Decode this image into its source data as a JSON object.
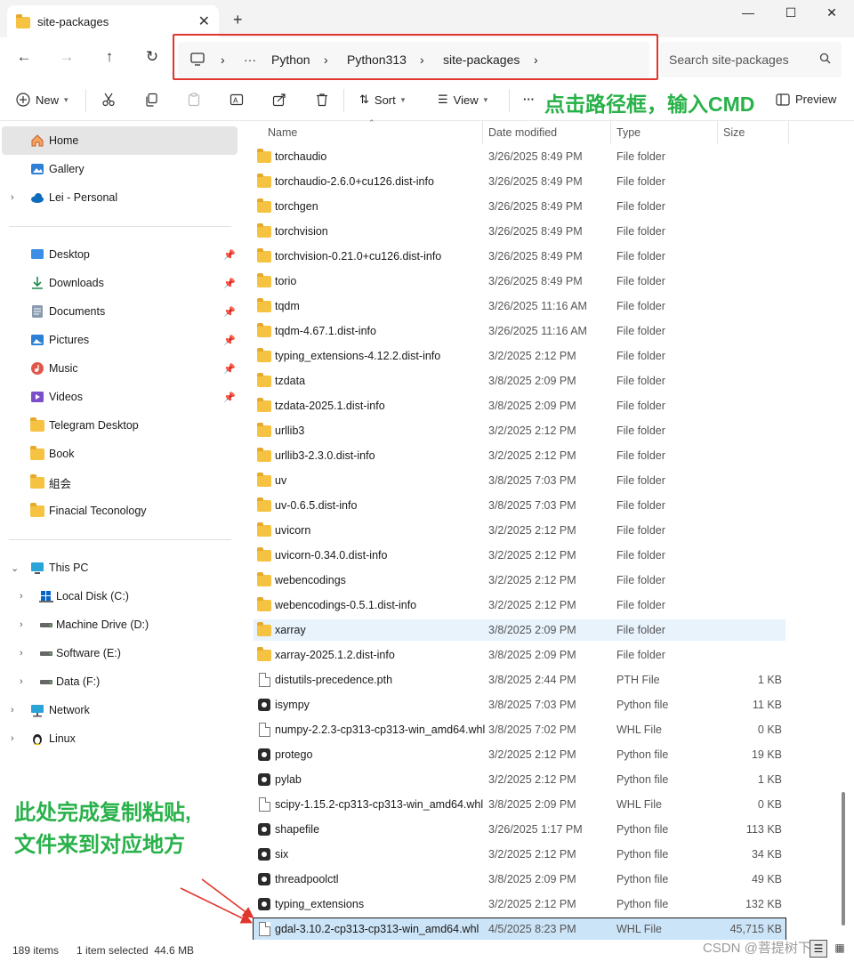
{
  "window": {
    "tab_title": "site-packages",
    "new_tab_glyph": "+",
    "tab_close_glyph": "✕",
    "minimize_glyph": "—",
    "maximize_glyph": "☐",
    "close_glyph": "✕"
  },
  "address": {
    "overflow": "···",
    "crumbs": [
      "Python",
      "Python313",
      "site-packages"
    ],
    "separator": "›",
    "search_placeholder": "Search site-packages"
  },
  "command_bar": {
    "new_label": "New",
    "sort_label": "Sort",
    "view_label": "View",
    "more_label": "···",
    "preview_label": "Preview",
    "annotation": "点击路径框，输入CMD"
  },
  "sidebar": {
    "home": "Home",
    "gallery": "Gallery",
    "onedrive": "Lei - Personal",
    "quick_access": [
      "Desktop",
      "Downloads",
      "Documents",
      "Pictures",
      "Music",
      "Videos",
      "Telegram Desktop",
      "Book",
      "組会",
      "Finacial Teconology"
    ],
    "this_pc": "This PC",
    "drives": [
      "Local Disk (C:)",
      "Machine Drive (D:)",
      "Software (E:)",
      "Data (F:)"
    ],
    "network": "Network",
    "linux": "Linux"
  },
  "columns": {
    "name": "Name",
    "date": "Date modified",
    "type": "Type",
    "size": "Size"
  },
  "files": [
    {
      "name": "torchaudio",
      "date": "3/26/2025 8:49 PM",
      "type": "File folder",
      "size": "",
      "icon": "folder"
    },
    {
      "name": "torchaudio-2.6.0+cu126.dist-info",
      "date": "3/26/2025 8:49 PM",
      "type": "File folder",
      "size": "",
      "icon": "folder"
    },
    {
      "name": "torchgen",
      "date": "3/26/2025 8:49 PM",
      "type": "File folder",
      "size": "",
      "icon": "folder"
    },
    {
      "name": "torchvision",
      "date": "3/26/2025 8:49 PM",
      "type": "File folder",
      "size": "",
      "icon": "folder"
    },
    {
      "name": "torchvision-0.21.0+cu126.dist-info",
      "date": "3/26/2025 8:49 PM",
      "type": "File folder",
      "size": "",
      "icon": "folder"
    },
    {
      "name": "torio",
      "date": "3/26/2025 8:49 PM",
      "type": "File folder",
      "size": "",
      "icon": "folder"
    },
    {
      "name": "tqdm",
      "date": "3/26/2025 11:16 AM",
      "type": "File folder",
      "size": "",
      "icon": "folder"
    },
    {
      "name": "tqdm-4.67.1.dist-info",
      "date": "3/26/2025 11:16 AM",
      "type": "File folder",
      "size": "",
      "icon": "folder"
    },
    {
      "name": "typing_extensions-4.12.2.dist-info",
      "date": "3/2/2025 2:12 PM",
      "type": "File folder",
      "size": "",
      "icon": "folder"
    },
    {
      "name": "tzdata",
      "date": "3/8/2025 2:09 PM",
      "type": "File folder",
      "size": "",
      "icon": "folder"
    },
    {
      "name": "tzdata-2025.1.dist-info",
      "date": "3/8/2025 2:09 PM",
      "type": "File folder",
      "size": "",
      "icon": "folder"
    },
    {
      "name": "urllib3",
      "date": "3/2/2025 2:12 PM",
      "type": "File folder",
      "size": "",
      "icon": "folder"
    },
    {
      "name": "urllib3-2.3.0.dist-info",
      "date": "3/2/2025 2:12 PM",
      "type": "File folder",
      "size": "",
      "icon": "folder"
    },
    {
      "name": "uv",
      "date": "3/8/2025 7:03 PM",
      "type": "File folder",
      "size": "",
      "icon": "folder"
    },
    {
      "name": "uv-0.6.5.dist-info",
      "date": "3/8/2025 7:03 PM",
      "type": "File folder",
      "size": "",
      "icon": "folder"
    },
    {
      "name": "uvicorn",
      "date": "3/2/2025 2:12 PM",
      "type": "File folder",
      "size": "",
      "icon": "folder"
    },
    {
      "name": "uvicorn-0.34.0.dist-info",
      "date": "3/2/2025 2:12 PM",
      "type": "File folder",
      "size": "",
      "icon": "folder"
    },
    {
      "name": "webencodings",
      "date": "3/2/2025 2:12 PM",
      "type": "File folder",
      "size": "",
      "icon": "folder"
    },
    {
      "name": "webencodings-0.5.1.dist-info",
      "date": "3/2/2025 2:12 PM",
      "type": "File folder",
      "size": "",
      "icon": "folder"
    },
    {
      "name": "xarray",
      "date": "3/8/2025 2:09 PM",
      "type": "File folder",
      "size": "",
      "icon": "folder",
      "state": "hover"
    },
    {
      "name": "xarray-2025.1.2.dist-info",
      "date": "3/8/2025 2:09 PM",
      "type": "File folder",
      "size": "",
      "icon": "folder"
    },
    {
      "name": "distutils-precedence.pth",
      "date": "3/8/2025 2:44 PM",
      "type": "PTH File",
      "size": "1 KB",
      "icon": "doc"
    },
    {
      "name": "isympy",
      "date": "3/8/2025 7:03 PM",
      "type": "Python file",
      "size": "11 KB",
      "icon": "python"
    },
    {
      "name": "numpy-2.2.3-cp313-cp313-win_amd64.whl",
      "date": "3/8/2025 7:02 PM",
      "type": "WHL File",
      "size": "0 KB",
      "icon": "doc"
    },
    {
      "name": "protego",
      "date": "3/2/2025 2:12 PM",
      "type": "Python file",
      "size": "19 KB",
      "icon": "python"
    },
    {
      "name": "pylab",
      "date": "3/2/2025 2:12 PM",
      "type": "Python file",
      "size": "1 KB",
      "icon": "python"
    },
    {
      "name": "scipy-1.15.2-cp313-cp313-win_amd64.whl",
      "date": "3/8/2025 2:09 PM",
      "type": "WHL File",
      "size": "0 KB",
      "icon": "doc"
    },
    {
      "name": "shapefile",
      "date": "3/26/2025 1:17 PM",
      "type": "Python file",
      "size": "113 KB",
      "icon": "python"
    },
    {
      "name": "six",
      "date": "3/2/2025 2:12 PM",
      "type": "Python file",
      "size": "34 KB",
      "icon": "python"
    },
    {
      "name": "threadpoolctl",
      "date": "3/8/2025 2:09 PM",
      "type": "Python file",
      "size": "49 KB",
      "icon": "python"
    },
    {
      "name": "typing_extensions",
      "date": "3/2/2025 2:12 PM",
      "type": "Python file",
      "size": "132 KB",
      "icon": "python"
    },
    {
      "name": "gdal-3.10.2-cp313-cp313-win_amd64.whl",
      "date": "4/5/2025 8:23 PM",
      "type": "WHL File",
      "size": "45,715 KB",
      "icon": "doc",
      "state": "selected"
    }
  ],
  "status": {
    "item_count": "189 items",
    "selection": "1 item selected  44.6 MB"
  },
  "annotation_bottom": [
    "此处完成复制粘贴,",
    "文件来到对应地方"
  ],
  "watermark": "CSDN @菩提树下呀",
  "colors": {
    "annotation": "#29b14a",
    "highlight_box": "#e0362c",
    "selection": "#cce4f7"
  }
}
